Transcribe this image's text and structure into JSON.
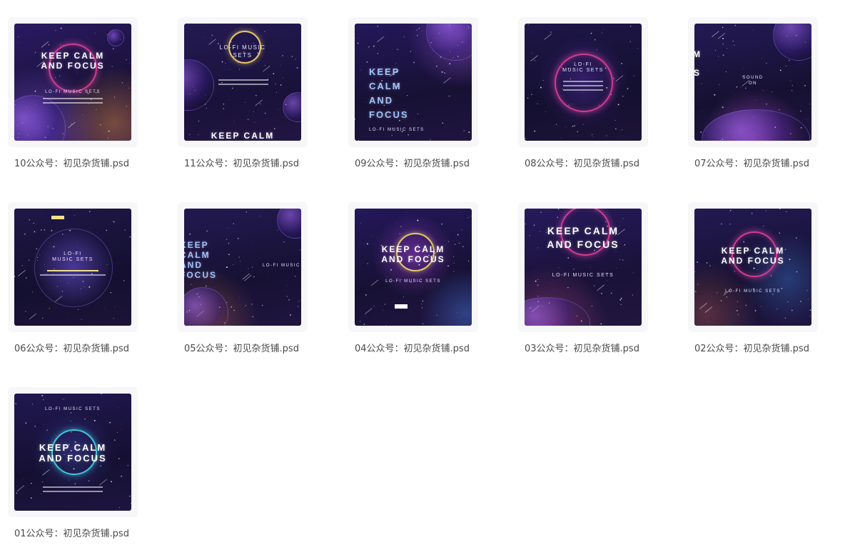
{
  "files": [
    {
      "caption": "10公众号：初见杂货铺.psd",
      "headline": "KEEP CALM\nAND FOCUS",
      "subtitle": "LO-FI MUSIC SETS"
    },
    {
      "caption": "11公众号：初见杂货铺.psd",
      "headline": "KEEP CALM",
      "subtitle": "LO-FI MUSIC\nSETS"
    },
    {
      "caption": "09公众号：初见杂货铺.psd",
      "headline": "KEEP\nCALM\nAND\nFOCUS",
      "subtitle": "LO-FI MUSIC SETS"
    },
    {
      "caption": "08公众号：初见杂货铺.psd",
      "headline": "",
      "subtitle": "LO-FI\nMUSIC SETS"
    },
    {
      "caption": "07公众号：初见杂货铺.psd",
      "headline": "M\nS",
      "subtitle": "SOUND\nON"
    },
    {
      "caption": "06公众号：初见杂货铺.psd",
      "headline": "",
      "subtitle": "LO-FI\nMUSIC SETS"
    },
    {
      "caption": "05公众号：初见杂货铺.psd",
      "headline": "KEEP\nCALM\nAND\nFOCUS",
      "subtitle": "LO-FI MUSIC"
    },
    {
      "caption": "04公众号：初见杂货铺.psd",
      "headline": "KEEP CALM\nAND FOCUS",
      "subtitle": "LO-FI MUSIC SETS"
    },
    {
      "caption": "03公众号：初见杂货铺.psd",
      "headline": "KEEP CALM\nAND FOCUS",
      "subtitle": "LO-FI MUSIC SETS"
    },
    {
      "caption": "02公众号：初见杂货铺.psd",
      "headline": "KEEP CALM\nAND FOCUS",
      "subtitle": "LO-FI MUSIC SETS"
    },
    {
      "caption": "01公众号：初见杂货铺.psd",
      "headline": "KEEP CALM\nAND FOCUS",
      "subtitle": "LO-FI MUSIC SETS"
    }
  ],
  "colors": {
    "caption_text": "#4a4a4a",
    "thumb_frame": "#f7f7f9",
    "space_dark": "#1d1440",
    "ring_pink": "#d13c8f",
    "ring_yellow": "#e6c86a",
    "ring_cyan": "#3fc6d8",
    "headline_blue": "#9fc4ff"
  }
}
